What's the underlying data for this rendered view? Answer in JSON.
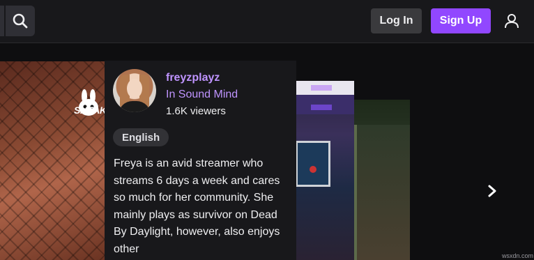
{
  "header": {
    "login_label": "Log In",
    "signup_label": "Sign Up",
    "search_icon": "search-icon",
    "user_icon": "user-icon"
  },
  "carousel": {
    "thumbnail_text": "SNEAK",
    "next_icon": "chevron-right-icon"
  },
  "streamer_card": {
    "name": "freyzplayz",
    "game": "In Sound Mind",
    "viewers": "1.6K viewers",
    "tag": "English",
    "description": "Freya is an avid streamer who streams 6 days a week and cares so much for her community. She mainly plays as survivor on Dead By Daylight, however, also enjoys other"
  },
  "watermark": "wsxdn.com",
  "colors": {
    "accent": "#9147ff",
    "accent_text": "#bf94ff",
    "background": "#0e0e10",
    "topbar": "#18181b"
  }
}
